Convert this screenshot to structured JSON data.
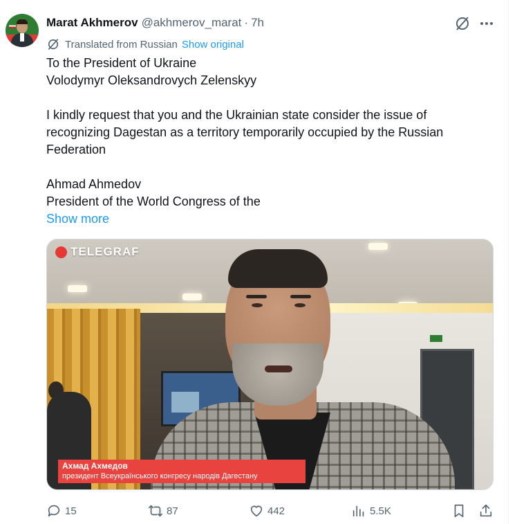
{
  "tweet": {
    "author_name": "Marat Akhmerov",
    "author_handle": "@akhmerov_marat",
    "separator": "·",
    "time": "7h",
    "translated_label": "Translated from Russian",
    "show_original_label": "Show original",
    "body_lines": [
      "To the President of Ukraine",
      "Volodymyr Oleksandrovych Zelenskyy",
      "",
      "I kindly request that you and the Ukrainian state consider the issue of",
      "recognizing Dagestan as a territory temporarily occupied by the Russian",
      "Federation",
      "",
      "Ahmad Ahmedov",
      "President of the World Congress of the"
    ],
    "show_more_label": "Show more"
  },
  "media": {
    "logo_text": "TELEGRAF",
    "caption_name": "Ахмад Ахмедов",
    "caption_title": "президент Всеукраїнського конгресу народів Дагестану"
  },
  "actions": {
    "replies": "15",
    "reposts": "87",
    "likes": "442",
    "views": "5.5K"
  },
  "icons": {
    "grok": "grok-icon",
    "more": "more-dots-icon",
    "translate": "translate-icon",
    "reply": "reply-icon",
    "repost": "repost-icon",
    "like": "heart-icon",
    "views": "views-chart-icon",
    "bookmark": "bookmark-icon",
    "share": "share-icon"
  },
  "colors": {
    "link": "#1d9bf0",
    "secondary_text": "#536471",
    "primary_text": "#0f1419",
    "caption_bg": "#e8433f"
  }
}
